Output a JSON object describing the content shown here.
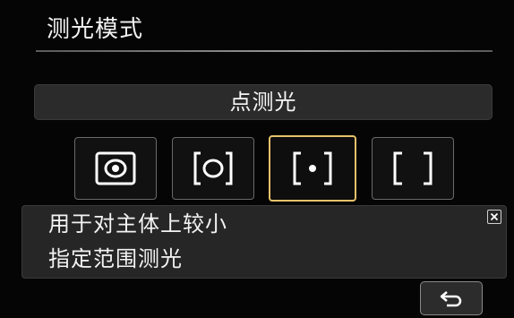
{
  "header": {
    "title": "测光模式"
  },
  "selection": {
    "current_mode_label": "点测光"
  },
  "modes": [
    {
      "icon": "evaluative-metering-icon",
      "selected": false
    },
    {
      "icon": "partial-metering-icon",
      "selected": false
    },
    {
      "icon": "spot-metering-icon",
      "selected": true
    },
    {
      "icon": "center-weighted-metering-icon",
      "selected": false
    }
  ],
  "description": {
    "line1": "用于对主体上较小",
    "line2": "指定范围测光",
    "close_icon": "close-icon"
  },
  "footer": {
    "back_icon": "return-icon"
  },
  "colors": {
    "selection_highlight": "#e6c26a",
    "background": "#050505",
    "panel": "#262626"
  }
}
